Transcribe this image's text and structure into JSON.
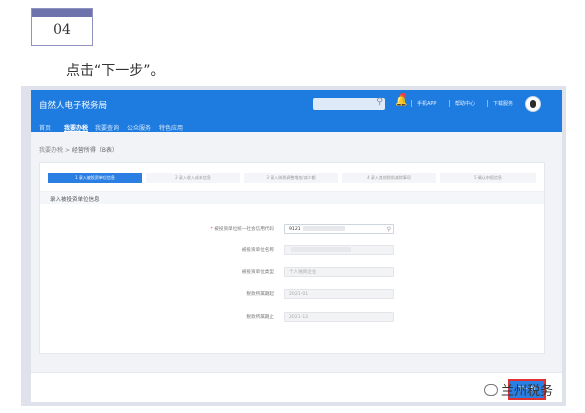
{
  "step_badge": {
    "number": "04"
  },
  "instruction": "点击“下一步”。",
  "app": {
    "title": "自然人电子税务局",
    "top_links": [
      "手机APP",
      "帮助中心",
      "下载服务"
    ],
    "nav": [
      "首页",
      "我要办税",
      "我要查询",
      "公众服务",
      "特色应用"
    ],
    "active_nav": "我要办税"
  },
  "breadcrumb": {
    "root": "我要办税",
    "separator": ">",
    "current": "经营所得（B表）"
  },
  "steps": [
    "1  录入被投资单位信息",
    "2  录入收入成本信息",
    "3  录入纳税调整增加/减少额",
    "4  录入其他税前减除事项",
    "5  确认申报信息"
  ],
  "section": {
    "title": "录入被投资单位信息",
    "fields": [
      {
        "label": "被投资单位统一社会信用代码",
        "value": "9121",
        "required": true
      },
      {
        "label": "被投资单位名称",
        "value": ""
      },
      {
        "label": "被投资单位类型",
        "value": "个人独资企业"
      },
      {
        "label": "税款所属期起",
        "value": "2021-01"
      },
      {
        "label": "税款所属期止",
        "value": "2021-12"
      }
    ]
  },
  "next_button": "下一步",
  "watermark": "兰州税务",
  "colors": {
    "primary": "#1e7ce0",
    "highlight": "#e03030"
  }
}
